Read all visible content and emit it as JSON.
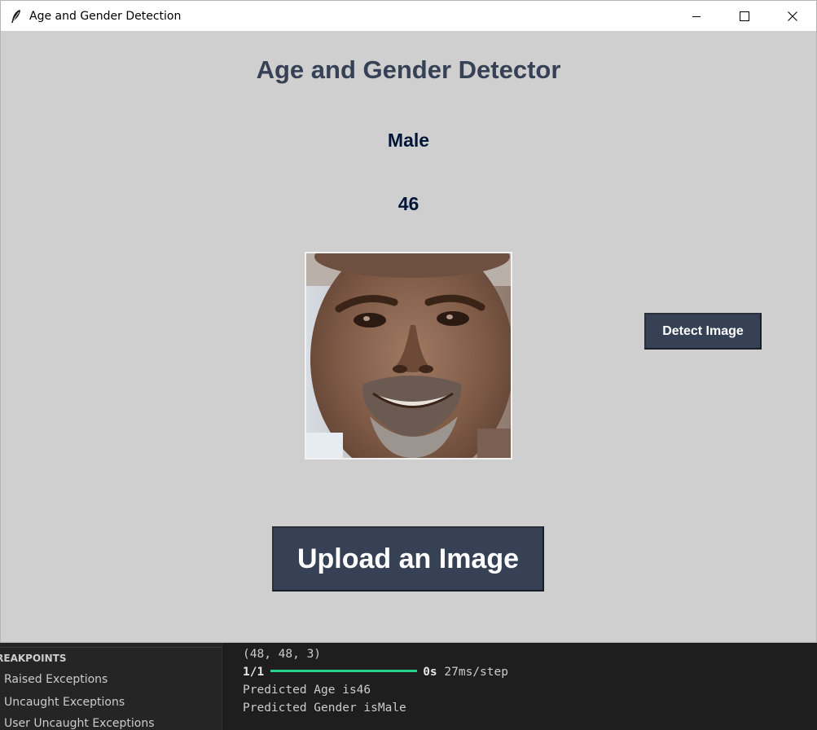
{
  "window": {
    "title": "Age and Gender Detection",
    "controls": {
      "minimize": "minimize-icon",
      "maximize": "maximize-icon",
      "close": "close-icon"
    }
  },
  "app": {
    "heading": "Age and Gender Detector",
    "gender": "Male",
    "age": "46",
    "detect_button": "Detect Image",
    "upload_button": "Upload an Image",
    "colors": {
      "background": "#cfcfcf",
      "button_bg": "#364156",
      "heading": "#364156",
      "label": "#011638"
    }
  },
  "breakpoints": {
    "header": "BREAKPOINTS",
    "items": [
      "Raised Exceptions",
      "Uncaught Exceptions",
      "User Uncaught Exceptions"
    ]
  },
  "terminal": {
    "shape_line": "(48, 48, 3)",
    "progress_step": "1/1",
    "progress_time": "0s",
    "progress_rate": "27ms/step",
    "progress_fraction": 1.0,
    "predicted_age": "Predicted Age is46",
    "predicted_gender": "Predicted Gender isMale",
    "colors": {
      "progress": "#23d18b"
    }
  }
}
